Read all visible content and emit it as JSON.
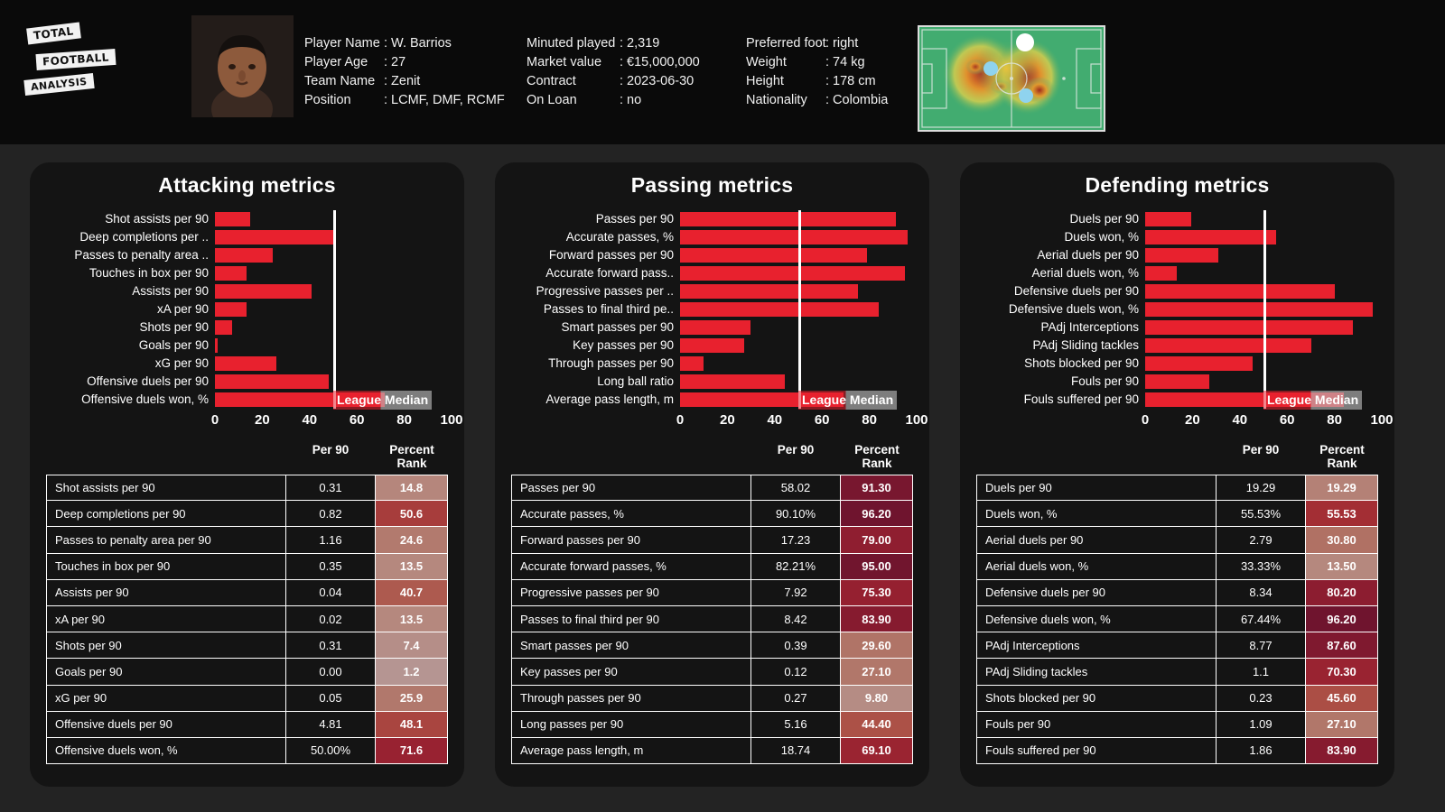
{
  "brand": {
    "line1": "TOTAL",
    "line2": "FOOTBALL",
    "line3": "ANALYSIS"
  },
  "player_info": {
    "column1": [
      {
        "key": "Player Name",
        "value": ": W. Barrios"
      },
      {
        "key": "Player Age",
        "value": ": 27"
      },
      {
        "key": "Team Name",
        "value": ": Zenit"
      },
      {
        "key": "Position",
        "value": ": LCMF, DMF, RCMF"
      }
    ],
    "column2": [
      {
        "key": "Minuted played",
        "value": ": 2,319"
      },
      {
        "key": "Market value",
        "value": ": €15,000,000"
      },
      {
        "key": "Contract",
        "value": ": 2023-06-30"
      },
      {
        "key": "On Loan",
        "value": ": no"
      }
    ],
    "column3": [
      {
        "key": "Preferred foot",
        "value": ": right"
      },
      {
        "key": "Weight",
        "value": ": 74 kg"
      },
      {
        "key": "Height",
        "value": ": 178 cm"
      },
      {
        "key": "Nationality",
        "value": ": Colombia"
      }
    ]
  },
  "median_label": "League Median",
  "table_headers": {
    "metric": "",
    "per90": "Per 90",
    "rank": "Percent Rank"
  },
  "colors": {
    "bar": "#e8212e",
    "median_line": "#ffffff",
    "panel_bg": "#141414",
    "header_bg": "#0a0a0a",
    "page_bg": "#232323"
  },
  "chart_data": [
    {
      "type": "bar",
      "title": "Attacking metrics",
      "xlabel": "",
      "ylabel": "",
      "xlim": [
        0,
        100
      ],
      "ticks": [
        0,
        20,
        40,
        60,
        80,
        100
      ],
      "median": 50,
      "orientation": "horizontal",
      "grid": false,
      "categories": [
        "Shot assists per 90",
        "Deep completions per ..",
        "Passes to penalty area ..",
        "Touches in box per 90",
        "Assists per 90",
        "xA per 90",
        "Shots per 90",
        "Goals per 90",
        "xG per 90",
        "Offensive duels per 90",
        "Offensive duels won, %"
      ],
      "values": [
        14.8,
        50.6,
        24.6,
        13.5,
        40.7,
        13.5,
        7.4,
        1.2,
        25.9,
        48.1,
        71.6
      ],
      "table": {
        "rows": [
          {
            "metric": "Shot assists per 90",
            "per90": "0.31",
            "rank": "14.8"
          },
          {
            "metric": "Deep completions per 90",
            "per90": "0.82",
            "rank": "50.6"
          },
          {
            "metric": "Passes to penalty area per 90",
            "per90": "1.16",
            "rank": "24.6"
          },
          {
            "metric": "Touches in box per 90",
            "per90": "0.35",
            "rank": "13.5"
          },
          {
            "metric": "Assists per 90",
            "per90": "0.04",
            "rank": "40.7"
          },
          {
            "metric": "xA per 90",
            "per90": "0.02",
            "rank": "13.5"
          },
          {
            "metric": "Shots per 90",
            "per90": "0.31",
            "rank": "7.4"
          },
          {
            "metric": "Goals per 90",
            "per90": "0.00",
            "rank": "1.2"
          },
          {
            "metric": "xG per 90",
            "per90": "0.05",
            "rank": "25.9"
          },
          {
            "metric": "Offensive duels per 90",
            "per90": "4.81",
            "rank": "48.1"
          },
          {
            "metric": "Offensive duels won, %",
            "per90": "50.00%",
            "rank": "71.6"
          }
        ]
      }
    },
    {
      "type": "bar",
      "title": "Passing metrics",
      "xlabel": "",
      "ylabel": "",
      "xlim": [
        0,
        100
      ],
      "ticks": [
        0,
        20,
        40,
        60,
        80,
        100
      ],
      "median": 50,
      "orientation": "horizontal",
      "grid": false,
      "categories": [
        "Passes per 90",
        "Accurate passes, %",
        "Forward passes per 90",
        "Accurate forward pass..",
        "Progressive passes per ..",
        "Passes to final third pe..",
        "Smart passes per 90",
        "Key passes per 90",
        "Through passes per 90",
        "Long ball ratio",
        "Average pass length, m"
      ],
      "values": [
        91.3,
        96.2,
        79.0,
        95.0,
        75.3,
        83.9,
        29.6,
        27.1,
        9.8,
        44.4,
        69.1
      ],
      "table": {
        "rows": [
          {
            "metric": "Passes per 90",
            "per90": "58.02",
            "rank": "91.30"
          },
          {
            "metric": "Accurate passes, %",
            "per90": "90.10%",
            "rank": "96.20"
          },
          {
            "metric": "Forward passes per 90",
            "per90": "17.23",
            "rank": "79.00"
          },
          {
            "metric": "Accurate forward passes, %",
            "per90": "82.21%",
            "rank": "95.00"
          },
          {
            "metric": "Progressive passes per 90",
            "per90": "7.92",
            "rank": "75.30"
          },
          {
            "metric": "Passes to final third per 90",
            "per90": "8.42",
            "rank": "83.90"
          },
          {
            "metric": "Smart passes per 90",
            "per90": "0.39",
            "rank": "29.60"
          },
          {
            "metric": "Key passes per 90",
            "per90": "0.12",
            "rank": "27.10"
          },
          {
            "metric": "Through passes per 90",
            "per90": "0.27",
            "rank": "9.80"
          },
          {
            "metric": "Long passes per 90",
            "per90": "5.16",
            "rank": "44.40"
          },
          {
            "metric": "Average pass length, m",
            "per90": "18.74",
            "rank": "69.10"
          }
        ]
      }
    },
    {
      "type": "bar",
      "title": "Defending metrics",
      "xlabel": "",
      "ylabel": "",
      "xlim": [
        0,
        100
      ],
      "ticks": [
        0,
        20,
        40,
        60,
        80,
        100
      ],
      "median": 50,
      "orientation": "horizontal",
      "grid": false,
      "categories": [
        "Duels per 90",
        "Duels won, %",
        "Aerial duels per 90",
        "Aerial duels won, %",
        "Defensive duels per 90",
        "Defensive duels won, %",
        "PAdj Interceptions",
        "PAdj Sliding tackles",
        "Shots blocked per 90",
        "Fouls per 90",
        "Fouls suffered per 90"
      ],
      "values": [
        19.29,
        55.53,
        30.8,
        13.5,
        80.2,
        96.2,
        87.6,
        70.3,
        45.6,
        27.1,
        83.9
      ],
      "table": {
        "rows": [
          {
            "metric": "Duels per 90",
            "per90": "19.29",
            "rank": "19.29"
          },
          {
            "metric": "Duels won, %",
            "per90": "55.53%",
            "rank": "55.53"
          },
          {
            "metric": "Aerial duels per 90",
            "per90": "2.79",
            "rank": "30.80"
          },
          {
            "metric": "Aerial duels won, %",
            "per90": "33.33%",
            "rank": "13.50"
          },
          {
            "metric": "Defensive duels per 90",
            "per90": "8.34",
            "rank": "80.20"
          },
          {
            "metric": "Defensive duels won, %",
            "per90": "67.44%",
            "rank": "96.20"
          },
          {
            "metric": "PAdj Interceptions",
            "per90": "8.77",
            "rank": "87.60"
          },
          {
            "metric": "PAdj Sliding tackles",
            "per90": "1.1",
            "rank": "70.30"
          },
          {
            "metric": "Shots blocked per 90",
            "per90": "0.23",
            "rank": "45.60"
          },
          {
            "metric": "Fouls per 90",
            "per90": "1.09",
            "rank": "27.10"
          },
          {
            "metric": "Fouls suffered per 90",
            "per90": "1.86",
            "rank": "83.90"
          }
        ]
      }
    }
  ]
}
